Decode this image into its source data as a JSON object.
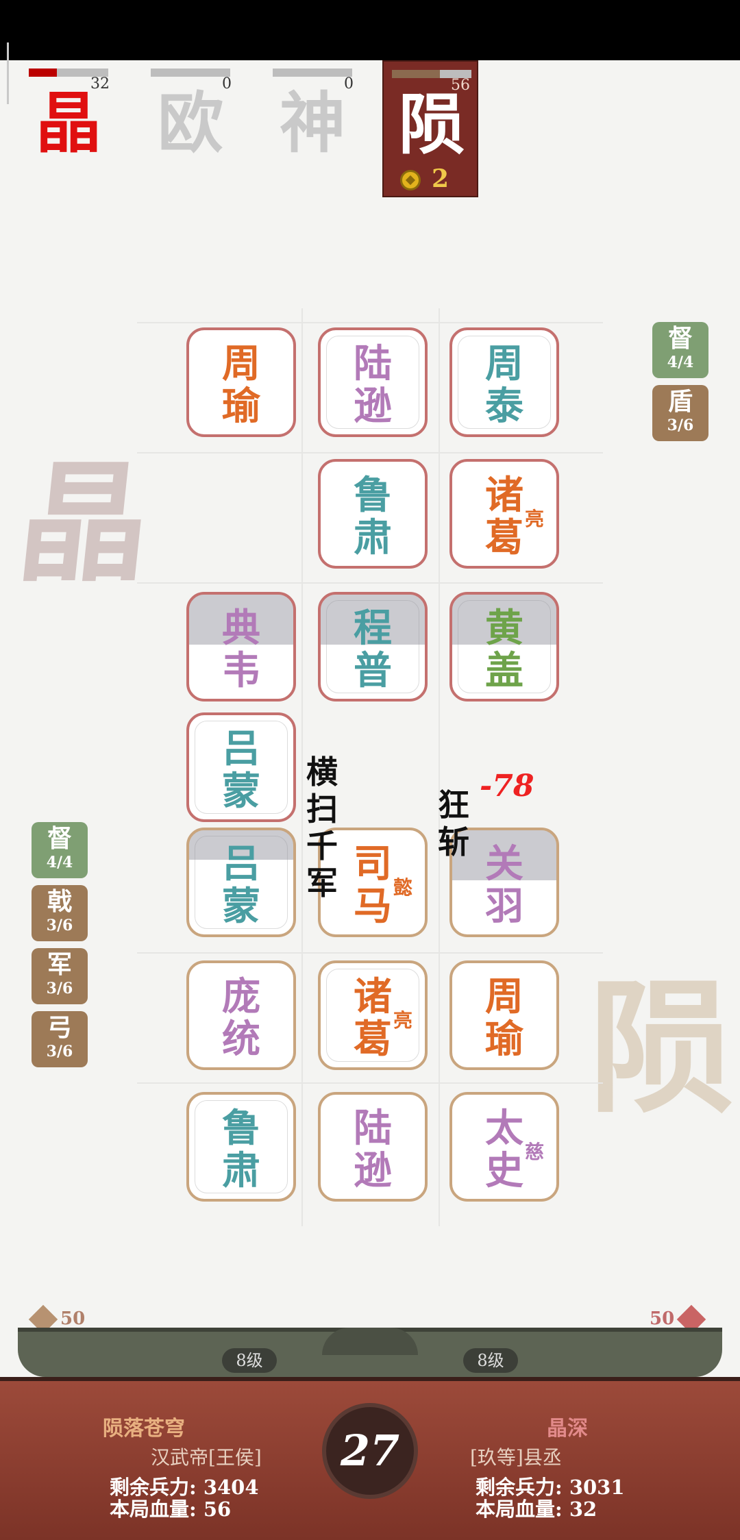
{
  "players": [
    {
      "char": "晶",
      "hp": 32,
      "hp_fraction": 0.35,
      "color": "#e01010",
      "active": false
    },
    {
      "char": "欧",
      "hp": 0,
      "hp_fraction": 0,
      "color": "#c9c9c9",
      "active": false
    },
    {
      "char": "神",
      "hp": 0,
      "hp_fraction": 0,
      "color": "#c9c9c9",
      "active": false
    },
    {
      "char": "陨",
      "hp": 56,
      "hp_fraction": 0.6,
      "color": "#ffffff",
      "active": true,
      "coins": "2"
    }
  ],
  "watermarks": {
    "left": "晶",
    "right": "陨"
  },
  "enemy_badges": [
    {
      "char": "督",
      "count": "4/4",
      "color": "#7f9f73"
    },
    {
      "char": "盾",
      "count": "3/6",
      "color": "#9d7a57"
    }
  ],
  "own_badges": [
    {
      "char": "督",
      "count": "4/4",
      "color": "#7f9f73"
    },
    {
      "char": "戟",
      "count": "3/6",
      "color": "#9d7a57"
    },
    {
      "char": "军",
      "count": "3/6",
      "color": "#9d7a57"
    },
    {
      "char": "弓",
      "count": "3/6",
      "color": "#9d7a57"
    }
  ],
  "enemy_units": [
    {
      "name1": "周",
      "name2": "瑜",
      "sub": "",
      "color": "orange"
    },
    {
      "name1": "陆",
      "name2": "逊",
      "sub": "",
      "color": "purple"
    },
    {
      "name1": "周",
      "name2": "泰",
      "sub": "",
      "color": "teal"
    },
    {
      "name1": "鲁",
      "name2": "肃",
      "sub": "",
      "color": "teal"
    },
    {
      "name1": "诸",
      "name2": "葛",
      "sub": "亮",
      "color": "orange"
    },
    {
      "name1": "典",
      "name2": "韦",
      "sub": "",
      "color": "purple"
    },
    {
      "name1": "程",
      "name2": "普",
      "sub": "",
      "color": "teal"
    },
    {
      "name1": "黄",
      "name2": "盖",
      "sub": "",
      "color": "green"
    },
    {
      "name1": "吕",
      "name2": "蒙",
      "sub": "",
      "color": "teal"
    }
  ],
  "own_units": [
    {
      "name1": "吕",
      "name2": "蒙",
      "sub": "",
      "color": "teal"
    },
    {
      "name1": "司",
      "name2": "马",
      "sub": "懿",
      "color": "orange"
    },
    {
      "name1": "关",
      "name2": "羽",
      "sub": "",
      "color": "purple"
    },
    {
      "name1": "庞",
      "name2": "统",
      "sub": "",
      "color": "purple"
    },
    {
      "name1": "诸",
      "name2": "葛",
      "sub": "亮",
      "color": "orange"
    },
    {
      "name1": "周",
      "name2": "瑜",
      "sub": "",
      "color": "orange"
    },
    {
      "name1": "鲁",
      "name2": "肃",
      "sub": "",
      "color": "teal"
    },
    {
      "name1": "陆",
      "name2": "逊",
      "sub": "",
      "color": "purple"
    },
    {
      "name1": "太",
      "name2": "史",
      "sub": "慈",
      "color": "purple"
    }
  ],
  "effects": {
    "skill1": [
      "横",
      "扫",
      "千",
      "军"
    ],
    "skill2": [
      "狂",
      "斩"
    ],
    "damage": "-78"
  },
  "costs": {
    "left": "50",
    "right": "50"
  },
  "levels": {
    "left": "8级",
    "right": "8级"
  },
  "bottom": {
    "timer": "27",
    "left": {
      "name": "陨落苍穹",
      "title": "汉武帝[王侯]",
      "troops_label": "剩余兵力:",
      "troops": "3404",
      "hp_label": "本局血量:",
      "hp": "56"
    },
    "right": {
      "name": "晶深",
      "title": "[玖等]县丞",
      "troops_label": "剩余兵力:",
      "troops": "3031",
      "hp_label": "本局血量:",
      "hp": "32"
    }
  }
}
